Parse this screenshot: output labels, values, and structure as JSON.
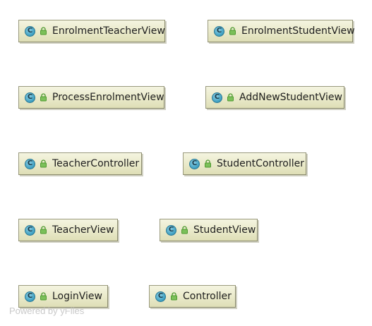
{
  "diagram": {
    "nodes": [
      {
        "id": "enrolment-teacher-view",
        "label": "EnrolmentTeacherView",
        "icon_letter": "C",
        "icon": "class-icon",
        "access_icon": "lock-icon"
      },
      {
        "id": "enrolment-student-view",
        "label": "EnrolmentStudentView",
        "icon_letter": "C",
        "icon": "class-icon",
        "access_icon": "lock-icon"
      },
      {
        "id": "process-enrolment-view",
        "label": "ProcessEnrolmentView",
        "icon_letter": "C",
        "icon": "class-icon",
        "access_icon": "lock-icon"
      },
      {
        "id": "add-new-student-view",
        "label": "AddNewStudentView",
        "icon_letter": "C",
        "icon": "class-icon",
        "access_icon": "lock-icon"
      },
      {
        "id": "teacher-controller",
        "label": "TeacherController",
        "icon_letter": "C",
        "icon": "class-icon",
        "access_icon": "lock-icon"
      },
      {
        "id": "student-controller",
        "label": "StudentController",
        "icon_letter": "C",
        "icon": "class-icon",
        "access_icon": "lock-icon"
      },
      {
        "id": "teacher-view",
        "label": "TeacherView",
        "icon_letter": "C",
        "icon": "class-icon",
        "access_icon": "lock-icon"
      },
      {
        "id": "student-view",
        "label": "StudentView",
        "icon_letter": "C",
        "icon": "class-icon",
        "access_icon": "lock-icon"
      },
      {
        "id": "login-view",
        "label": "LoginView",
        "icon_letter": "C",
        "icon": "class-icon",
        "access_icon": "lock-icon"
      },
      {
        "id": "controller",
        "label": "Controller",
        "icon_letter": "C",
        "icon": "class-icon",
        "access_icon": "lock-icon"
      }
    ]
  },
  "watermark": "Powered by yFiles",
  "colors": {
    "node_fill": "#e9e9c9",
    "node_border": "#9a9a7e",
    "class_icon": "#3d9fc0",
    "lock_icon": "#5aa63a",
    "text": "#1e1e1e",
    "watermark": "#c9c9c9"
  }
}
